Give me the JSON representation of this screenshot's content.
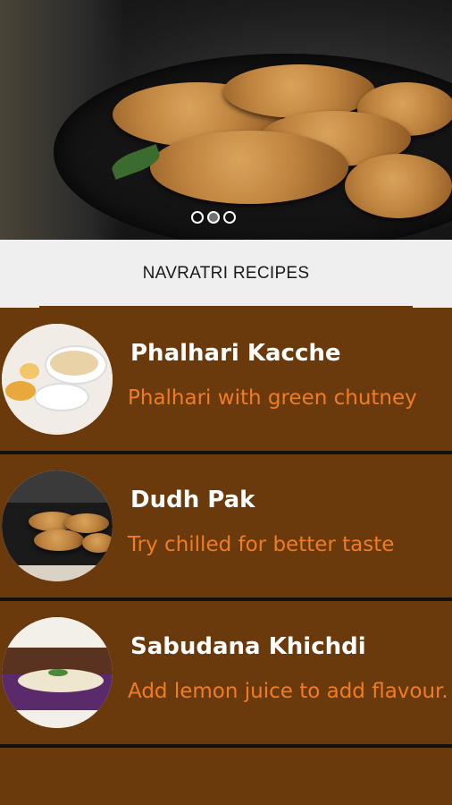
{
  "banner": {
    "image": "fried-patties-in-pan",
    "indicators": [
      {
        "active": false
      },
      {
        "active": true
      },
      {
        "active": false
      }
    ]
  },
  "header": {
    "title": "NAVRATRI RECIPES"
  },
  "recipes": [
    {
      "title": "Phalhari Kacche",
      "description": "Phalhari with green chutney",
      "thumbnail": "phalhari-plates"
    },
    {
      "title": "Dudh Pak",
      "description": "Try chilled for better taste",
      "thumbnail": "patties-pan"
    },
    {
      "title": "Sabudana Khichdi",
      "description": "Add lemon juice to add flavour.",
      "thumbnail": "khichdi-bowl"
    }
  ],
  "colors": {
    "background": "#6b3a0c",
    "title": "#ffffff",
    "description": "#f07c23",
    "header_bar": "#efefef",
    "divider": "#111111"
  }
}
